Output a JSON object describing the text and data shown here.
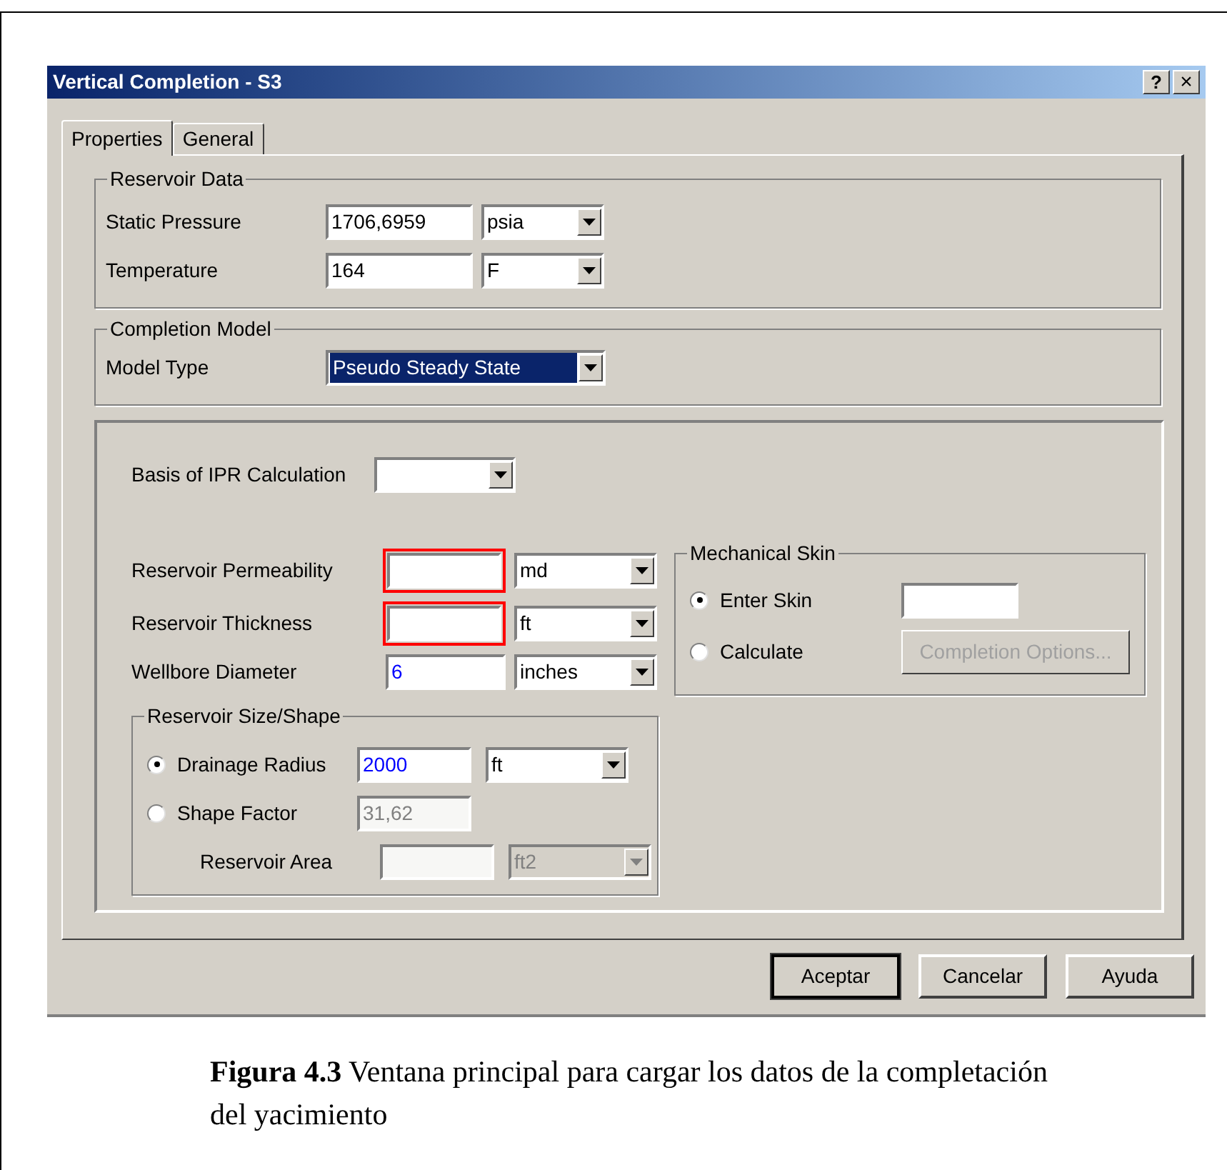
{
  "window": {
    "title": "Vertical Completion - S3",
    "help_button": "?",
    "close_button": "×"
  },
  "tabs": [
    {
      "label": "Properties",
      "selected": true
    },
    {
      "label": "General",
      "selected": false
    }
  ],
  "reservoir_data": {
    "title": "Reservoir Data",
    "rows": [
      {
        "label": "Static Pressure",
        "value": "1706,6959",
        "unit": "psia"
      },
      {
        "label": "Temperature",
        "value": "164",
        "unit": "F"
      }
    ]
  },
  "completion_model": {
    "title": "Completion Model",
    "label": "Model Type",
    "value": "Pseudo Steady State",
    "highlighted": true
  },
  "basis": {
    "label": "Basis of IPR Calculation"
  },
  "fields": [
    {
      "label": "Reservoir Permeability",
      "unit": "md",
      "required": true
    },
    {
      "label": "Reservoir Thickness",
      "unit": "ft",
      "required": true
    },
    {
      "label": "Wellbore Diameter",
      "value": "6",
      "unit": "inches",
      "required": false
    }
  ],
  "mechanical_skin": {
    "title": "Mechanical Skin",
    "options": [
      {
        "kind": "field",
        "label": "Enter Skin",
        "selected": true
      },
      {
        "kind": "button",
        "label": "Calculate",
        "selected": false,
        "button": "Completion Options...",
        "disabled": true
      }
    ]
  },
  "size_shape": {
    "title": "Reservoir Size/Shape",
    "rows": [
      {
        "kind": "radio",
        "label": "Drainage Radius",
        "selected": true,
        "value": "2000",
        "unit": "ft",
        "disabled": false
      },
      {
        "kind": "radio",
        "label": "Shape Factor",
        "selected": false,
        "value": "31,62",
        "disabled": true
      },
      {
        "kind": "plain",
        "label": "Reservoir Area",
        "unit": "ft2",
        "disabled": true
      }
    ]
  },
  "buttons": [
    {
      "label": "Aceptar",
      "default": true
    },
    {
      "label": "Cancelar",
      "default": false
    },
    {
      "label": "Ayuda",
      "default": false
    }
  ],
  "caption": "**Figura 4.3** Ventana principal para cargar los datos de la completación del yacimiento"
}
